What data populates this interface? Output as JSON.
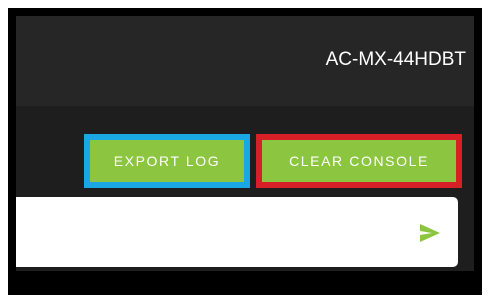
{
  "header": {
    "device_name": "AC-MX-44HDBT"
  },
  "toolbar": {
    "export_label": "EXPORT LOG",
    "clear_label": "CLEAR CONSOLE"
  },
  "console": {
    "input_value": "",
    "send_icon": "send-icon"
  },
  "colors": {
    "accent_green": "#8cc540",
    "export_highlight": "#1aa8e4",
    "clear_highlight": "#d61f26"
  }
}
